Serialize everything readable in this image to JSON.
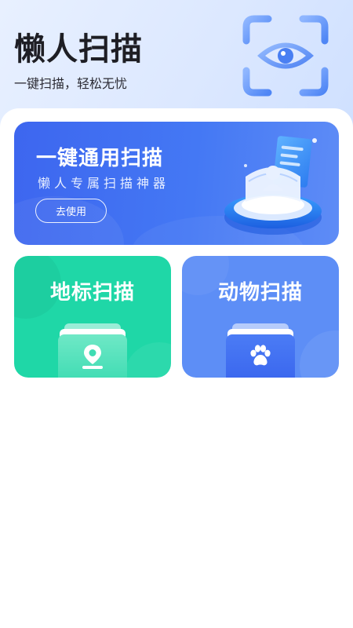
{
  "header": {
    "title": "懒人扫描",
    "subtitle": "一键扫描，轻松无忧"
  },
  "main_card": {
    "title": "一键通用扫描",
    "subtitle": "懒人专属扫描神器",
    "button_label": "去使用"
  },
  "cards": [
    {
      "title": "地标扫描",
      "icon": "location-pin-icon"
    },
    {
      "title": "动物扫描",
      "icon": "paw-icon"
    }
  ],
  "colors": {
    "main_card": "#4478f4",
    "landmark_card": "#1fd7a7",
    "animal_card": "#5d8ef6",
    "header_bg": "#dce8ff"
  }
}
